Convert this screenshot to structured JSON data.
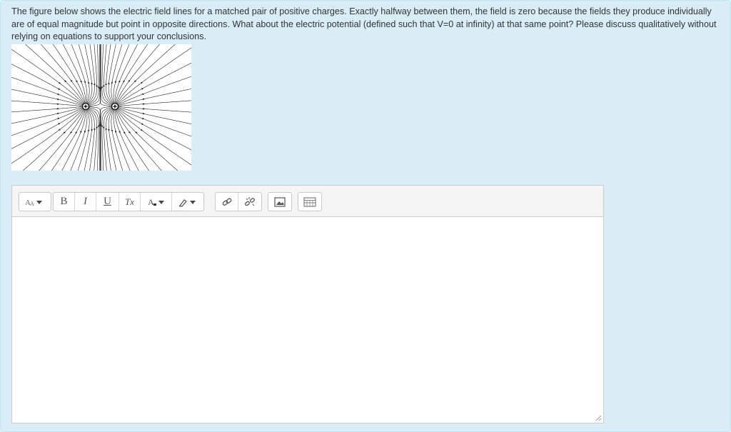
{
  "question": {
    "text": "The figure below shows the electric field lines for a matched pair of positive charges. Exactly halfway between them, the field is zero because the fields they produce individually are of equal magnitude but point in opposite directions. What about the electric potential (defined such that V=0 at infinity) at that same point? Please discuss qualitatively without relying on equations to support your conclusions."
  },
  "figure": {
    "charge_count": 2
  },
  "toolbar": {
    "bold_label": "B",
    "italic_label": "I",
    "underline_label": "U",
    "clear_format_label": "Tx"
  },
  "editor": {
    "content": ""
  },
  "colors": {
    "panel_bg": "#d9edf7",
    "panel_border": "#bce8f1",
    "toolbar_bg": "#f5f5f5",
    "text": "#333333"
  }
}
